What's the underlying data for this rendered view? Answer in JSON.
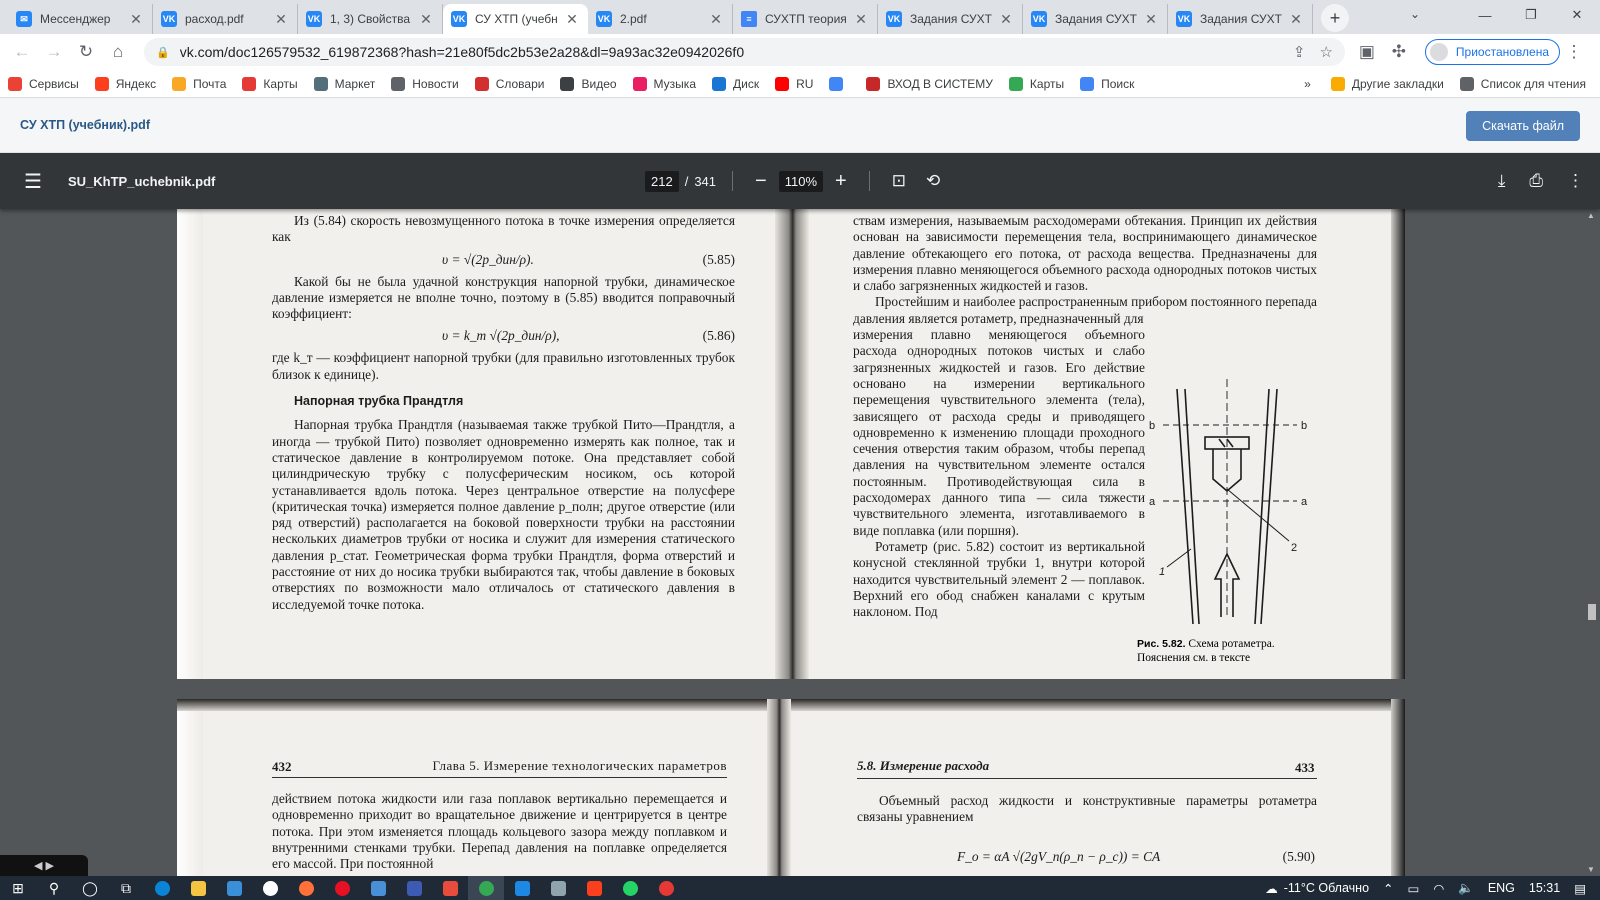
{
  "browser": {
    "tabs": [
      {
        "title": "Мессенджер",
        "icon": "vk-messenger-icon",
        "active": false
      },
      {
        "title": "расход.pdf",
        "icon": "vk-icon",
        "active": false
      },
      {
        "title": "1, 3) Свойства",
        "icon": "vk-icon",
        "active": false
      },
      {
        "title": "СУ ХТП (учебн",
        "icon": "vk-icon",
        "active": true
      },
      {
        "title": "2.pdf",
        "icon": "vk-icon",
        "active": false
      },
      {
        "title": "СУХТП теория",
        "icon": "google-docs-icon",
        "active": false
      },
      {
        "title": "Задания СУХТ",
        "icon": "vk-icon",
        "active": false
      },
      {
        "title": "Задания СУХТ",
        "icon": "vk-icon",
        "active": false
      },
      {
        "title": "Задания СУХТ",
        "icon": "vk-icon",
        "active": false
      }
    ],
    "url": "vk.com/doc126579532_619872368?hash=21e80f5dc2b53e2a28&dl=9a93ac32e0942026f0",
    "profile_label": "Приостановлена",
    "bookmarks": [
      {
        "label": "Сервисы",
        "color": "#ea4335"
      },
      {
        "label": "Яндекс",
        "color": "#fc3f1d"
      },
      {
        "label": "Почта",
        "color": "#f9a825"
      },
      {
        "label": "Карты",
        "color": "#e53935"
      },
      {
        "label": "Маркет",
        "color": "#546e7a"
      },
      {
        "label": "Новости",
        "color": "#5f6368"
      },
      {
        "label": "Словари",
        "color": "#d32f2f"
      },
      {
        "label": "Видео",
        "color": "#3c4043"
      },
      {
        "label": "Музыка",
        "color": "#e91e63"
      },
      {
        "label": "Диск",
        "color": "#1976d2"
      },
      {
        "label": "RU",
        "color": "#ff0000"
      },
      {
        "label": "",
        "color": "#4285f4"
      },
      {
        "label": "ВХОД В СИСТЕМУ",
        "color": "#c62828"
      },
      {
        "label": "Карты",
        "color": "#34a853"
      },
      {
        "label": "Поиск",
        "color": "#4285f4"
      }
    ],
    "more_bookmarks": "»",
    "other_bookmarks": "Другие закладки",
    "reading_list": "Список для чтения"
  },
  "vk": {
    "doc_title": "СУ ХТП (учебник).pdf",
    "download_label": "Скачать файл"
  },
  "pdf": {
    "file_name": "SU_KhTP_uchebnik.pdf",
    "page_current": "212",
    "page_sep": "/",
    "page_total": "341",
    "zoom": "110%",
    "left_page": {
      "p1": "Из (5.84) скорость невозмущенного потока в точке измерения определяется как",
      "f1": "υ = √(2p_дин/ρ).",
      "f1_num": "(5.85)",
      "p2": "Какой бы не была удачной конструкция напорной трубки, динамическое давление измеряется не вполне точно, поэтому в (5.85) вводится поправочный коэффициент:",
      "f2": "υ = k_т √(2p_дин/ρ),",
      "f2_num": "(5.86)",
      "p3": "где k_т — коэффициент напорной трубки (для правильно изготовленных трубок близок к единице).",
      "heading": "Напорная трубка Прандтля",
      "p4": "Напорная трубка Прандтля (называемая также трубкой Пито—Прандтля, а иногда — трубкой Пито) позволяет одновременно измерять как полное, так и статическое давление в контролируемом потоке. Она представляет собой цилиндрическую трубку с полусферическим носиком, ось которой устанавливается вдоль потока. Через центральное отверстие на полусфере (критическая точка) измеряется полное давление p_полн; другое отверстие (или ряд отверстий) располагается на боковой поверхности трубки на расстоянии нескольких диаметров трубки от носика и служит для измерения статического давления p_стат. Геометрическая форма трубки Прандтля, форма отверстий и расстояние от них до носика трубки выбираются так, чтобы давление в боковых отверстиях по возможности мало отличалось от статического давления в исследуемой точке потока."
    },
    "right_page": {
      "p1": "ствам измерения, называемым расходомерами обтекания. Принцип их действия основан на зависимости перемещения тела, воспринимающего динамическое давление обтекающего его потока, от расхода вещества. Предназначены для измерения плавно меняющегося объемного расхода однородных потоков чистых и слабо загрязненных жидкостей и газов.",
      "p2a": "Простейшим и наиболее распространенным прибором постоянного перепада давления является ротаметр, предназначенный для",
      "p2b": "измерения плавно меняющегося объемного расхода однородных потоков чистых и слабо загрязненных жидкостей и газов. Его действие основано на измерении вертикального перемещения чувствительного элемента (тела), зависящего от расхода среды и приводящего одновременно к изменению площади проходного сечения отверстия таким образом, чтобы перепад давления на чувствительном элементе остался постоянным. Противодействующая сила в расходомерах данного типа — сила тяжести чувствительного элемента, изготавливаемого в виде поплавка (или поршня).",
      "p3": "Ротаметр (рис. 5.82) состоит из вертикальной конусной стеклянной трубки 1, внутри которой находится чувствительный элемент 2 — поплавок. Верхний его обод снабжен каналами с крутым наклоном. Под",
      "fig_labels": {
        "b_left": "b",
        "b_right": "b",
        "a_left": "a",
        "a_right": "a",
        "n1": "1",
        "n2": "2"
      },
      "caption_bold": "Рис. 5.82.",
      "caption": "Схема ротаметра. Пояснения см. в тексте"
    },
    "next_left": {
      "page_no": "432",
      "header": "Глава 5. Измерение технологических параметров",
      "text": "действием потока жидкости или газа поплавок вертикально перемещается и одновременно приходит во вращательное движение и центрируется в центре потока. При этом изменяется площадь кольцевого зазора между поплавком и внутренними стенками трубки. Перепад давления на поплавке определяется его массой. При постоянной"
    },
    "next_right": {
      "header": "5.8. Измерение расхода",
      "page_no": "433",
      "text": "Объемный расход жидкости и конструктивные параметры ротаметра связаны уравнением",
      "formula": "F_о = αA √(2gV_п(ρ_п − ρ_с)) = CA",
      "formula_num": "(5.90)"
    }
  },
  "taskbar": {
    "weather": "-11°C  Облачно",
    "lang": "ENG",
    "time": "15:31"
  }
}
